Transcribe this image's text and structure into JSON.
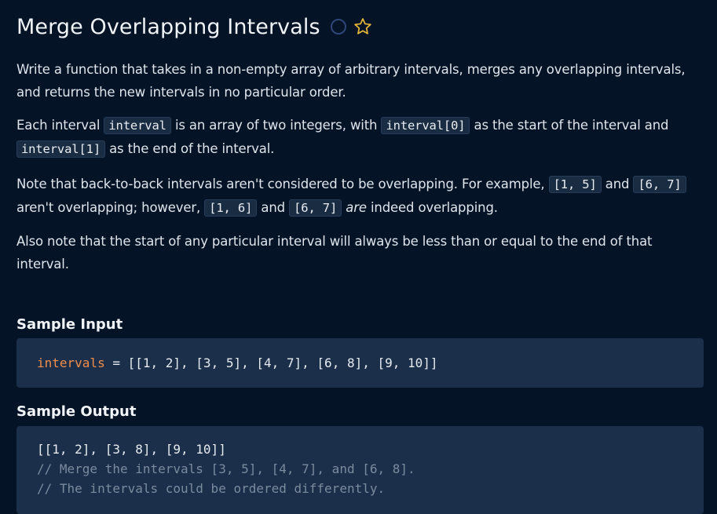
{
  "problem": {
    "title": "Merge Overlapping Intervals",
    "icons": {
      "status": "circle-icon",
      "favorite": "star-icon"
    },
    "colors": {
      "background": "#041326",
      "code_background": "#1b2f4a",
      "variable": "#f08d49",
      "comment": "#7a8b9e",
      "star": "#e8b83a"
    },
    "p1": "Write a function that takes in a non-empty array of arbitrary intervals, merges any overlapping intervals, and returns the new intervals in no particular order.",
    "p2": {
      "t1": "Each interval ",
      "c1": "interval",
      "t2": " is an array of two integers, with ",
      "c2": "interval[0]",
      "t3": " as the start of the interval and ",
      "c3": "interval[1]",
      "t4": " as the end of the interval."
    },
    "p3": {
      "t1": "Note that back-to-back intervals aren't considered to be overlapping. For example, ",
      "c1": "[1, 5]",
      "t2": " and ",
      "c2": "[6, 7]",
      "t3": " aren't overlapping; however, ",
      "c3": "[1, 6]",
      "t4": " and ",
      "c4": "[6, 7]",
      "em": "are",
      "t5": " indeed overlapping."
    },
    "p4": "Also note that the start of any particular interval will always be less than or equal to the end of that interval."
  },
  "sample_input": {
    "heading": "Sample Input",
    "var_name": "intervals",
    "rest": " = [[1, 2], [3, 5], [4, 7], [6, 8], [9, 10]]"
  },
  "sample_output": {
    "heading": "Sample Output",
    "line1": "[[1, 2], [3, 8], [9, 10]]",
    "comment1": "// Merge the intervals [3, 5], [4, 7], and [6, 8].",
    "comment2": "// The intervals could be ordered differently."
  }
}
